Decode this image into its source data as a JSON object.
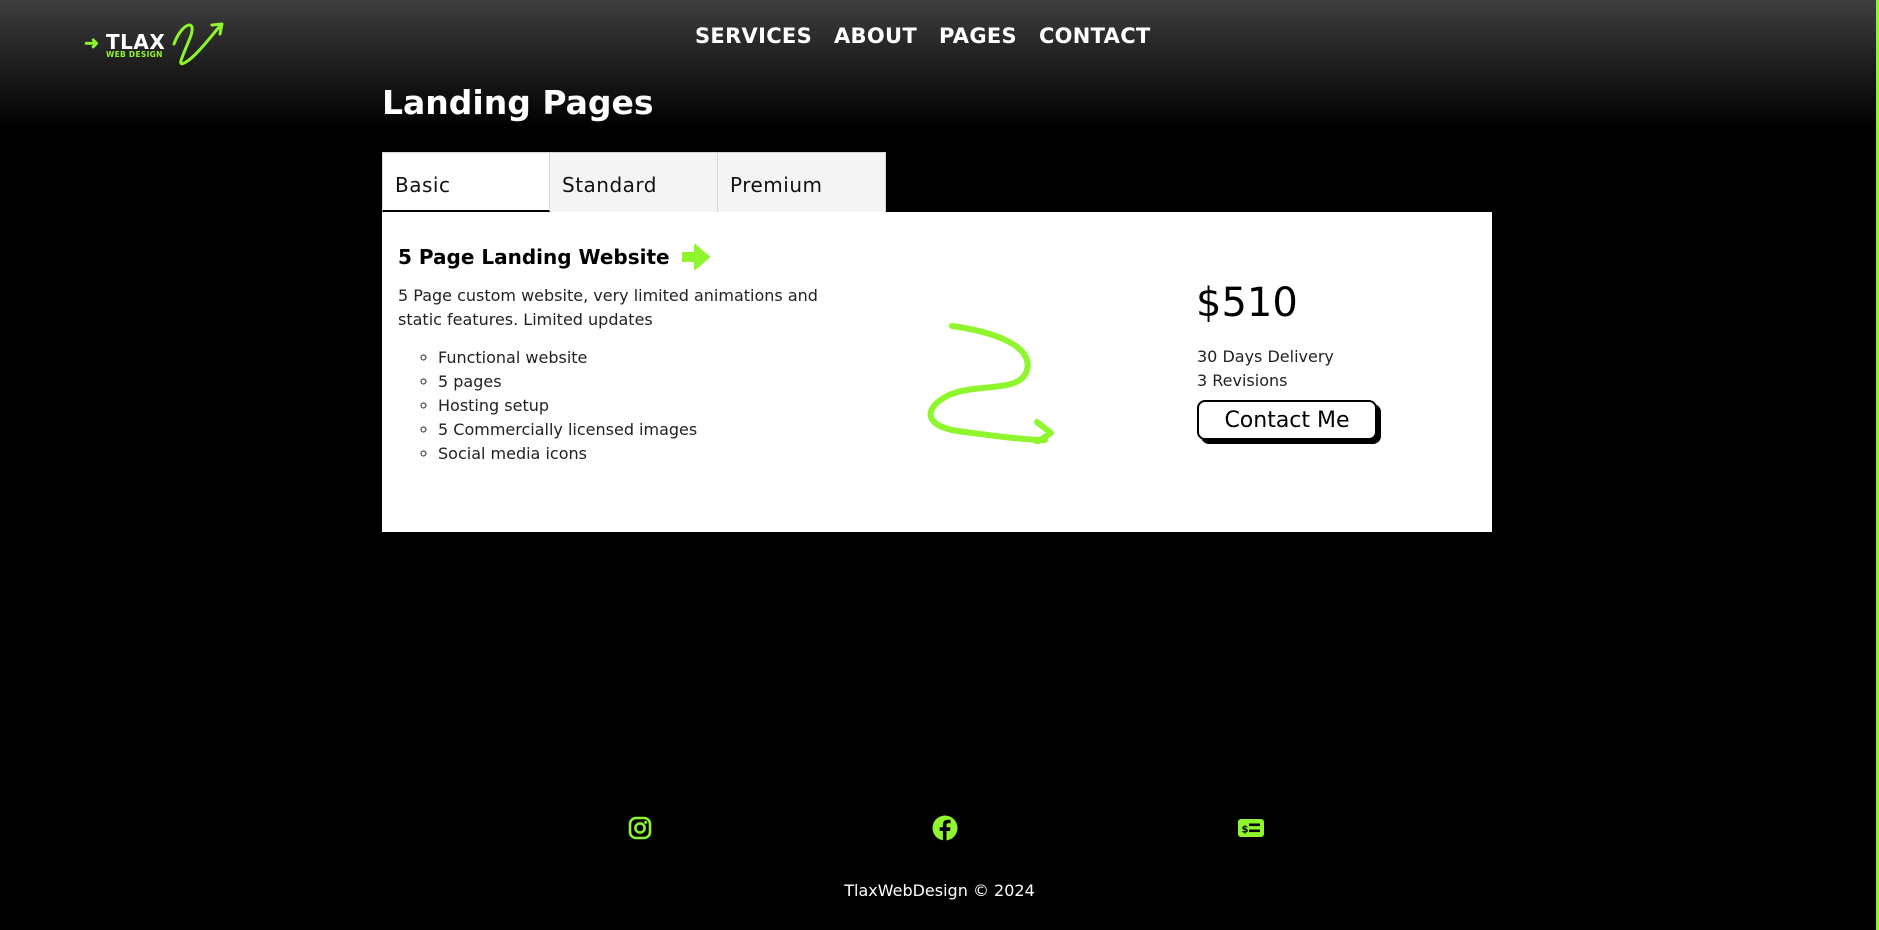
{
  "logo": {
    "main": "TLAX",
    "sub": "WEB DESIGN",
    "arrow": "➜"
  },
  "nav": [
    {
      "label": "SERVICES"
    },
    {
      "label": "ABOUT"
    },
    {
      "label": "PAGES"
    },
    {
      "label": "CONTACT"
    }
  ],
  "page_title": "Landing Pages",
  "tabs": [
    {
      "label": "Basic",
      "active": true
    },
    {
      "label": "Standard",
      "active": false
    },
    {
      "label": "Premium",
      "active": false
    }
  ],
  "plan": {
    "title": "5 Page Landing Website",
    "description": "5 Page custom website, very limited animations and static features. Limited updates",
    "features": [
      "Functional website",
      "5 pages",
      "Hosting setup",
      "5 Commercially licensed images",
      "Social media icons"
    ],
    "price": "$510",
    "delivery": "30 Days Delivery",
    "revisions": "3 Revisions",
    "cta": "Contact Me"
  },
  "social": [
    {
      "icon": "instagram-icon"
    },
    {
      "icon": "facebook-icon"
    },
    {
      "icon": "pricing-icon"
    }
  ],
  "footer": {
    "copyright": "TlaxWebDesign © 2024"
  },
  "colors": {
    "accent": "#8ff52c",
    "background": "#000000",
    "panel": "#ffffff"
  }
}
